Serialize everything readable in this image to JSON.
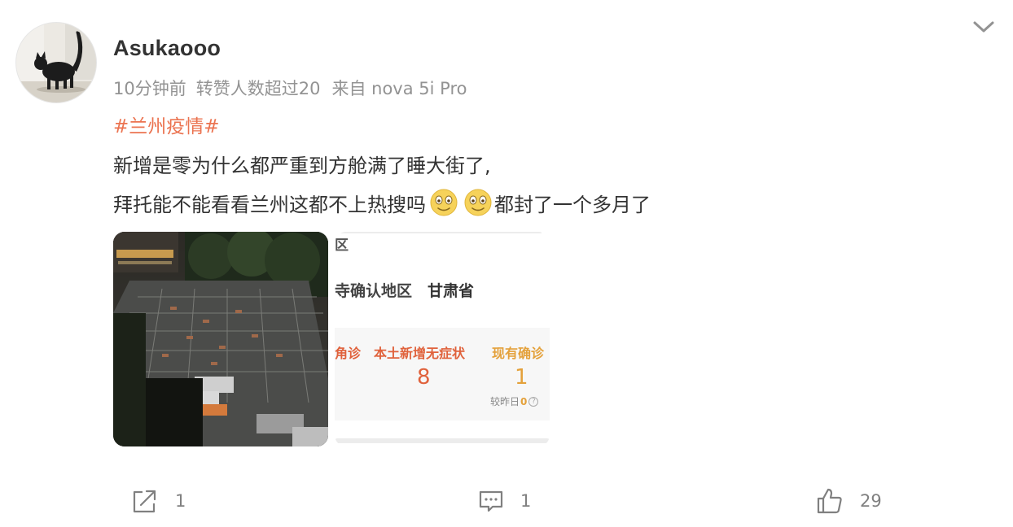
{
  "post": {
    "username": "Asukaooo",
    "meta": {
      "time": "10分钟前",
      "reposts_note": "转赞人数超过20",
      "source": "来自 nova 5i Pro"
    },
    "hashtag": "#兰州疫情#",
    "text_line1": "新增是零为什么都严重到方舱满了睡大街了,",
    "text_line2_part1": "拜托能不能看看兰州这都不上热搜吗",
    "text_line2_part2": "都封了一个多月了",
    "emoji_names": [
      "smile-emoji",
      "smile-emoji"
    ],
    "images": {
      "screenshot": {
        "fragment_top": "区",
        "region_label": "寺确认地区",
        "province": "甘肃省",
        "stat_partial_label": "角诊",
        "stat_b_label": "本土新增无症状",
        "stat_b_value": "8",
        "stat_c_label": "现有确诊",
        "stat_c_value": "1",
        "compare_label": "较昨日",
        "compare_value": "0"
      }
    }
  },
  "actions": {
    "share_count": "1",
    "comment_count": "1",
    "like_count": "29"
  },
  "icons": {
    "more": "chevron-down-icon",
    "share": "share-icon",
    "comment": "comment-icon",
    "like": "thumbs-up-icon"
  },
  "colors": {
    "hashtag": "#eb7350",
    "meta": "#939393",
    "text": "#333333",
    "action": "#808080"
  }
}
